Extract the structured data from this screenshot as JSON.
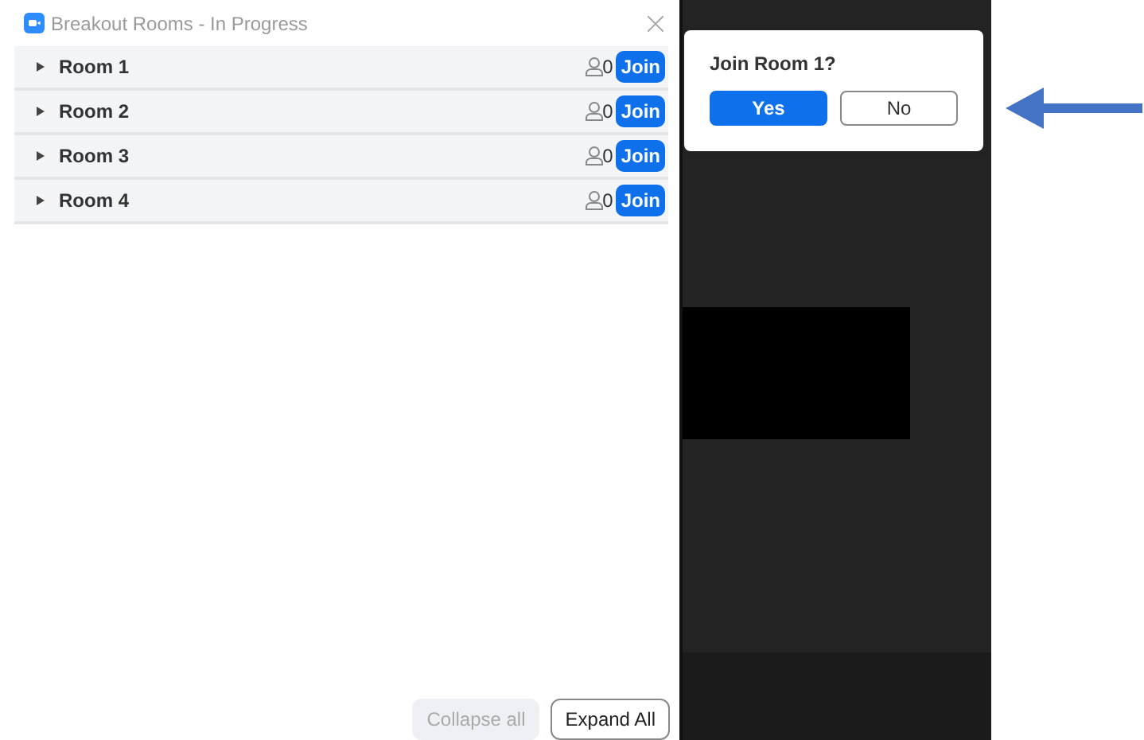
{
  "window": {
    "title": "Breakout Rooms - In Progress"
  },
  "rooms": [
    {
      "name": "Room 1",
      "count": "0",
      "action": "Join"
    },
    {
      "name": "Room 2",
      "count": "0",
      "action": "Join"
    },
    {
      "name": "Room 3",
      "count": "0",
      "action": "Join"
    },
    {
      "name": "Room 4",
      "count": "0",
      "action": "Join"
    }
  ],
  "footer_buttons": [
    {
      "label": "Collapse all",
      "disabled": true
    },
    {
      "label": "Expand All",
      "disabled": false
    }
  ],
  "popup": {
    "question": "Join Room 1?",
    "buttons": [
      {
        "label": "Yes",
        "kind": "primary"
      },
      {
        "label": "No",
        "kind": "secondary"
      }
    ]
  }
}
